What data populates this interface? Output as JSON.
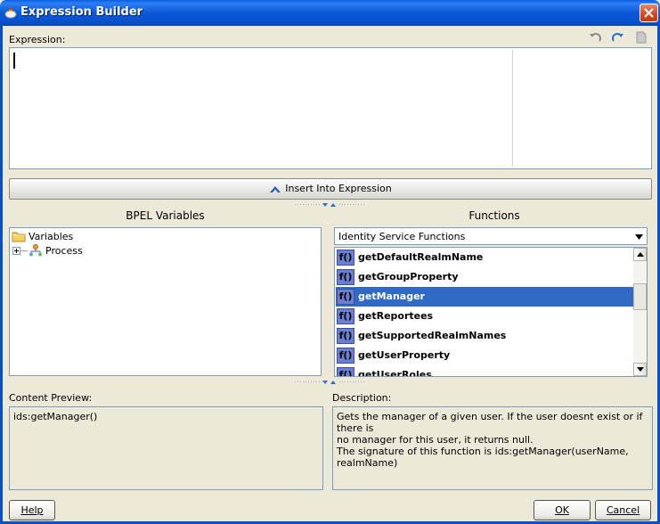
{
  "window": {
    "title": "Expression Builder"
  },
  "expression": {
    "label": "Expression:",
    "value": ""
  },
  "toolbar": {
    "icons": [
      "undo-icon",
      "redo-icon",
      "clear-icon"
    ]
  },
  "insert_button": {
    "label": "Insert Into Expression"
  },
  "bpel_panel": {
    "heading": "BPEL Variables",
    "tree": [
      {
        "label": "Variables",
        "icon": "folder-icon"
      },
      {
        "label": "Process",
        "icon": "process-icon",
        "expander": "+"
      }
    ]
  },
  "functions_panel": {
    "heading": "Functions",
    "category": "Identity Service Functions",
    "fx_glyph": "f()",
    "items": [
      {
        "name": "getDefaultRealmName",
        "selected": false
      },
      {
        "name": "getGroupProperty",
        "selected": false
      },
      {
        "name": "getManager",
        "selected": true
      },
      {
        "name": "getReportees",
        "selected": false
      },
      {
        "name": "getSupportedRealmNames",
        "selected": false
      },
      {
        "name": "getUserProperty",
        "selected": false
      },
      {
        "name": "getUserRoles",
        "selected": false
      }
    ]
  },
  "content_preview": {
    "label": "Content Preview:",
    "value": "ids:getManager()"
  },
  "description": {
    "label": "Description:",
    "line1": "Gets the manager of a given user. If the user doesnt exist or if there is",
    "line2": "no manager for this user, it returns null.",
    "line3": "The signature of this function is ids:getManager(userName, realmName)"
  },
  "footer": {
    "help_label": "Help",
    "ok_label": "OK",
    "cancel_label": "Cancel"
  },
  "colors": {
    "titlebar": "#0a58d8",
    "selection": "#316ac5",
    "dialog_bg": "#ece9d8"
  }
}
